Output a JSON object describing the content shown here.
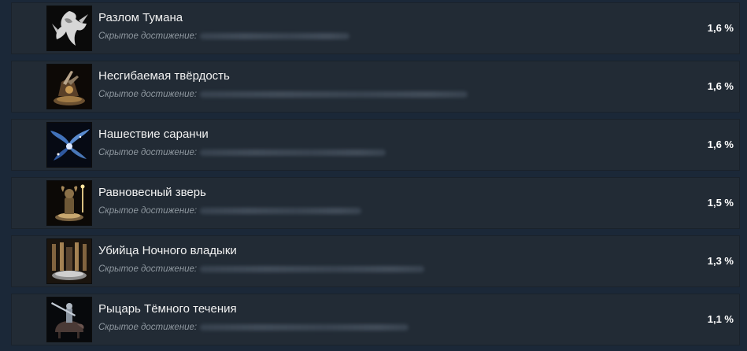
{
  "achievements": [
    {
      "title": "Разлом Тумана",
      "hidden_label": "Скрытое достижение:",
      "percent": "1,6 %",
      "icon": "white-dragon-icon"
    },
    {
      "title": "Несгибаемая твёрдость",
      "hidden_label": "Скрытое достижение:",
      "percent": "1,6 %",
      "icon": "broken-armor-altar-icon"
    },
    {
      "title": "Нашествие саранчи",
      "hidden_label": "Скрытое достижение:",
      "percent": "1,6 %",
      "icon": "blue-winged-locust-icon"
    },
    {
      "title": "Равновесный зверь",
      "hidden_label": "Скрытое достижение:",
      "percent": "1,5 %",
      "icon": "golden-beast-statue-icon"
    },
    {
      "title": "Убийца Ночного владыки",
      "hidden_label": "Скрытое достижение:",
      "percent": "1,3 %",
      "icon": "candlelit-altar-icon"
    },
    {
      "title": "Рыцарь Тёмного течения",
      "hidden_label": "Скрытое достижение:",
      "percent": "1,1 %",
      "icon": "knight-on-beast-icon"
    }
  ]
}
